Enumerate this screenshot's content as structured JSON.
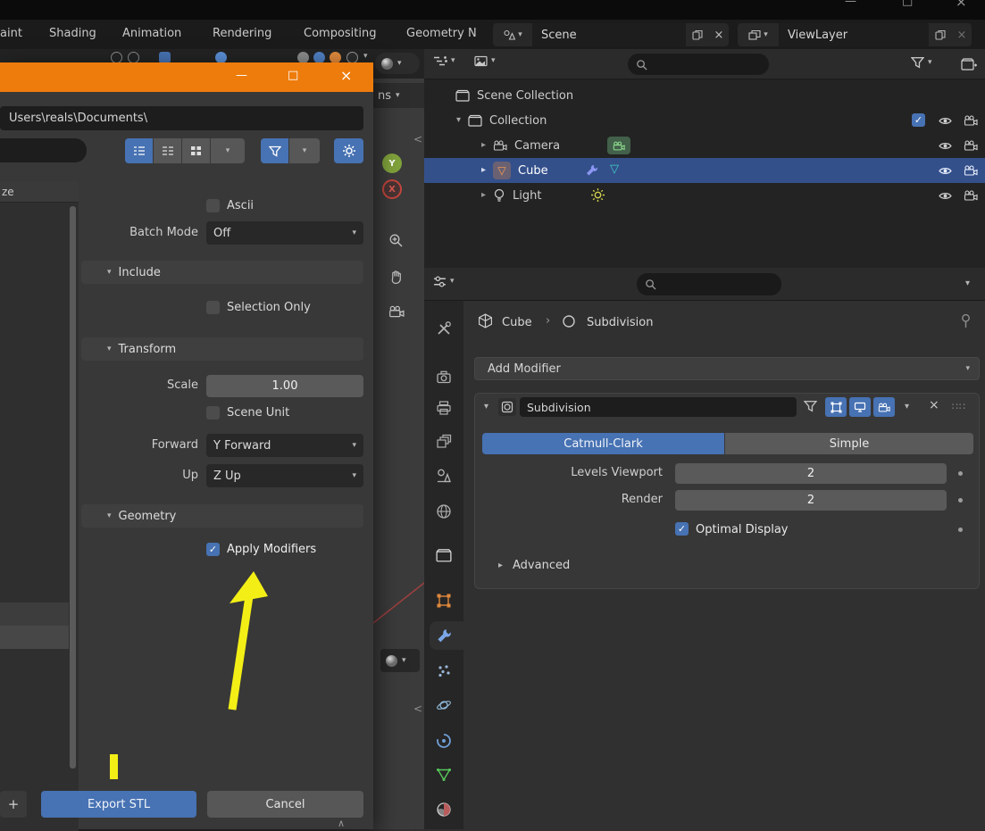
{
  "glyphs": {
    "minimize": "—",
    "maximize": "□",
    "close": "×",
    "chevron_down": "▾",
    "chevron_right": "▸",
    "chevron_left": "<",
    "caret_up": "∧",
    "check": "✓",
    "crumb_sep": "›",
    "drag": "∷∷",
    "plus": "+"
  },
  "window": {
    "controls": [
      "minimize",
      "maximize",
      "close"
    ]
  },
  "topbar": {
    "menus": [
      {
        "label": "aint"
      },
      {
        "label": "Shading"
      },
      {
        "label": "Animation"
      },
      {
        "label": "Rendering"
      },
      {
        "label": "Compositing"
      },
      {
        "label": "Geometry N"
      }
    ],
    "scene_selector": {
      "value": "Scene"
    },
    "view_layer_selector": {
      "value": "ViewLayer"
    }
  },
  "file_dialog": {
    "path_value": "Users\\reals\\Documents\\",
    "size_column_partial": "ze",
    "options": {
      "ascii": {
        "label": "Ascii",
        "checked": false
      },
      "batch_mode": {
        "label": "Batch Mode",
        "value": "Off"
      },
      "include_header": "Include",
      "selection_only": {
        "label": "Selection Only",
        "checked": false
      },
      "transform_header": "Transform",
      "scale": {
        "label": "Scale",
        "value": "1.00"
      },
      "scene_unit": {
        "label": "Scene Unit",
        "checked": false
      },
      "forward": {
        "label": "Forward",
        "value": "Y Forward"
      },
      "up": {
        "label": "Up",
        "value": "Z Up"
      },
      "geometry_header": "Geometry",
      "apply_modifiers": {
        "label": "Apply Modifiers",
        "checked": true
      }
    },
    "footer": {
      "new_folder": "+",
      "export": "Export STL",
      "cancel": "Cancel"
    }
  },
  "viewport": {
    "options_partial": "ns",
    "gizmo_y": "Y",
    "gizmo_x": "X"
  },
  "outliner": {
    "items": [
      {
        "label": "Scene Collection"
      },
      {
        "label": "Collection"
      },
      {
        "label": "Camera"
      },
      {
        "label": "Cube"
      },
      {
        "label": "Light"
      }
    ]
  },
  "properties": {
    "breadcrumb": {
      "object": "Cube",
      "modifier": "Subdivision"
    },
    "add_modifier_label": "Add Modifier",
    "modifier_panel": {
      "name": "Subdivision",
      "catmull_clark": "Catmull-Clark",
      "simple": "Simple",
      "levels_viewport": {
        "label": "Levels Viewport",
        "value": "2"
      },
      "render": {
        "label": "Render",
        "value": "2"
      },
      "optimal_display": {
        "label": "Optimal Display",
        "checked": true
      },
      "advanced_label": "Advanced"
    }
  },
  "colors": {
    "accent_blue": "#4772b3",
    "titlebar_orange": "#ee7c0c",
    "annotation_yellow": "#f3ef16",
    "selected_row": "#34508b"
  }
}
